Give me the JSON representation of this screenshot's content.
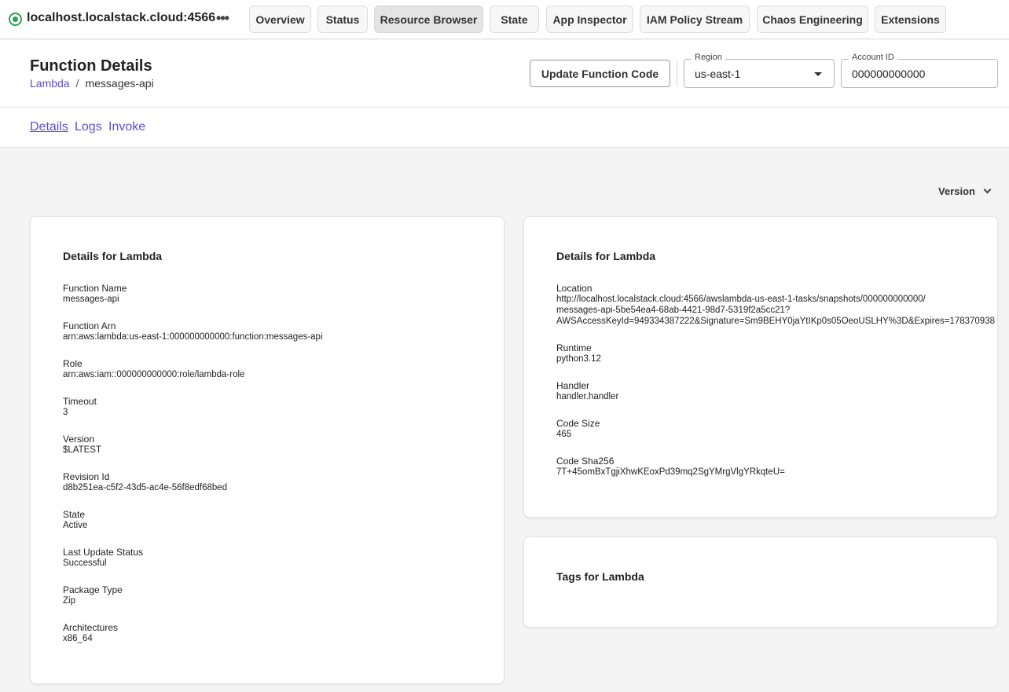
{
  "topbar": {
    "host": "localhost.localstack.cloud:4566",
    "tabs": [
      {
        "label": "Overview"
      },
      {
        "label": "Status"
      },
      {
        "label": "Resource Browser"
      },
      {
        "label": "State"
      },
      {
        "label": "App Inspector"
      },
      {
        "label": "IAM Policy Stream"
      },
      {
        "label": "Chaos Engineering"
      },
      {
        "label": "Extensions"
      }
    ],
    "active_tab": "Resource Browser",
    "status_color": "#2e9e54"
  },
  "header": {
    "title": "Function Details",
    "breadcrumb": {
      "parent": "Lambda",
      "separator": "/",
      "current": "messages-api"
    },
    "update_button": "Update Function Code",
    "region": {
      "label": "Region",
      "value": "us-east-1"
    },
    "account": {
      "label": "Account ID",
      "value": "000000000000"
    }
  },
  "subtabs": [
    {
      "label": "Details"
    },
    {
      "label": "Logs"
    },
    {
      "label": "Invoke"
    }
  ],
  "version_dropdown": "Version",
  "details_card": {
    "title": "Details for Lambda",
    "fields": [
      {
        "label": "Function Name",
        "value": "messages-api"
      },
      {
        "label": "Function Arn",
        "value": "arn:aws:lambda:us-east-1:000000000000:function:messages-api"
      },
      {
        "label": "Role",
        "value": "arn:aws:iam::000000000000:role/lambda-role"
      },
      {
        "label": "Timeout",
        "value": "3"
      },
      {
        "label": "Version",
        "value": "$LATEST"
      },
      {
        "label": "Revision Id",
        "value": "d8b251ea-c5f2-43d5-ac4e-56f8edf68bed"
      },
      {
        "label": "State",
        "value": "Active"
      },
      {
        "label": "Last Update Status",
        "value": "Successful"
      },
      {
        "label": "Package Type",
        "value": "Zip"
      },
      {
        "label": "Architectures",
        "value": "x86_64"
      }
    ]
  },
  "code_card": {
    "title": "Details for Lambda",
    "location": {
      "label": "Location",
      "lines": [
        "http://localhost.localstack.cloud:4566/awslambda-us-east-1-tasks/snapshots/000000000000/",
        "messages-api-5be54ea4-68ab-4421-98d7-5319f2a5cc21?",
        "AWSAccessKeyId=949334387222&Signature=Sm9BEHY0jaYtIKp0s05OeoUSLHY%3D&Expires=178370938"
      ]
    },
    "fields": [
      {
        "label": "Runtime",
        "value": "python3.12"
      },
      {
        "label": "Handler",
        "value": "handler.handler"
      },
      {
        "label": "Code Size",
        "value": "465"
      },
      {
        "label": "Code Sha256",
        "value": "7T+45omBxTgjiXhwKEoxPd39mq2SgYMrgVlgYRkqteU="
      }
    ]
  },
  "tags_card": {
    "title": "Tags for Lambda"
  },
  "colors": {
    "accent": "#5a4fcf",
    "background": "#f4f4f4"
  }
}
